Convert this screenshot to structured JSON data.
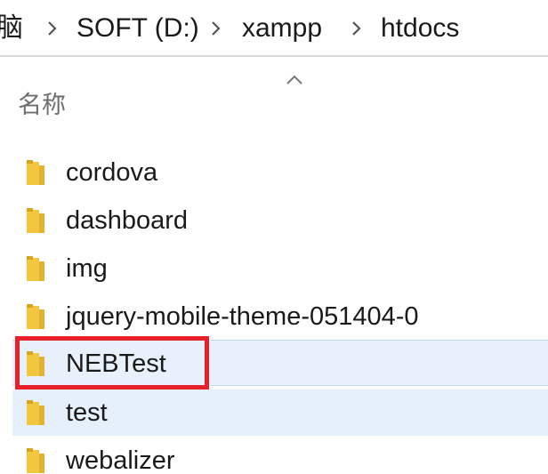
{
  "breadcrumb": {
    "items": [
      {
        "label": "脑"
      },
      {
        "label": "SOFT (D:)"
      },
      {
        "label": "xampp"
      },
      {
        "label": "htdocs"
      }
    ]
  },
  "columns": {
    "name_label": "名称",
    "sort_icon": "chevron-up-icon"
  },
  "files": [
    {
      "name": "cordova",
      "type": "folder"
    },
    {
      "name": "dashboard",
      "type": "folder"
    },
    {
      "name": "img",
      "type": "folder"
    },
    {
      "name": "jquery-mobile-theme-051404-0",
      "type": "folder"
    },
    {
      "name": "NEBTest",
      "type": "folder",
      "state": "hover"
    },
    {
      "name": "test",
      "type": "folder",
      "state": "highlighted"
    },
    {
      "name": "webalizer",
      "type": "folder"
    }
  ],
  "annotation": {
    "color": "#e8202a",
    "target": "NEBTest"
  },
  "colors": {
    "folder": "#f3c63f",
    "folder_dark": "#d9a520",
    "hover_bg": "#e8f1fb",
    "select_bg": "#e5f0fb"
  }
}
